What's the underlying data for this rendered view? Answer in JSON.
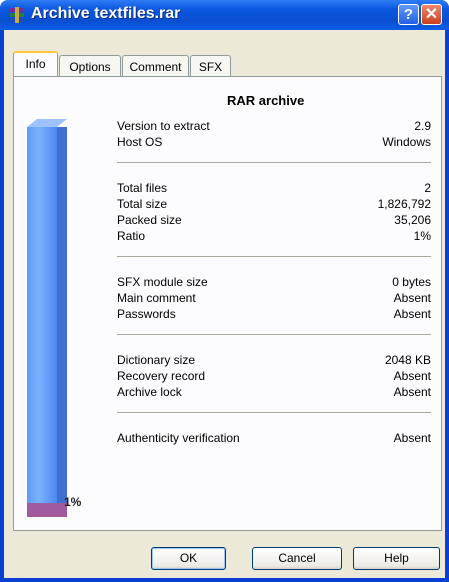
{
  "window": {
    "title": "Archive textfiles.rar",
    "help_glyph": "?",
    "close_glyph": "✕"
  },
  "tabs": [
    {
      "label": "Info",
      "active": true
    },
    {
      "label": "Options",
      "active": false
    },
    {
      "label": "Comment",
      "active": false
    },
    {
      "label": "SFX",
      "active": false
    }
  ],
  "info": {
    "heading": "RAR archive",
    "ratio_bar": {
      "fill_percent": 1,
      "label": "1%",
      "color_bar": "#5d9cf5",
      "color_fill": "#a05a9e"
    },
    "groups": [
      [
        {
          "label": "Version to extract",
          "value": "2.9"
        },
        {
          "label": "Host OS",
          "value": "Windows"
        }
      ],
      [
        {
          "label": "Total files",
          "value": "2"
        },
        {
          "label": "Total size",
          "value": "1,826,792"
        },
        {
          "label": "Packed size",
          "value": "35,206"
        },
        {
          "label": "Ratio",
          "value": "1%"
        }
      ],
      [
        {
          "label": "SFX module size",
          "value": "0 bytes"
        },
        {
          "label": "Main comment",
          "value": "Absent"
        },
        {
          "label": "Passwords",
          "value": "Absent"
        }
      ],
      [
        {
          "label": "Dictionary size",
          "value": "2048 KB"
        },
        {
          "label": "Recovery record",
          "value": "Absent"
        },
        {
          "label": "Archive lock",
          "value": "Absent"
        }
      ],
      [
        {
          "label": "Authenticity verification",
          "value": "Absent"
        }
      ]
    ]
  },
  "buttons": {
    "ok": "OK",
    "cancel": "Cancel",
    "help": "Help"
  }
}
